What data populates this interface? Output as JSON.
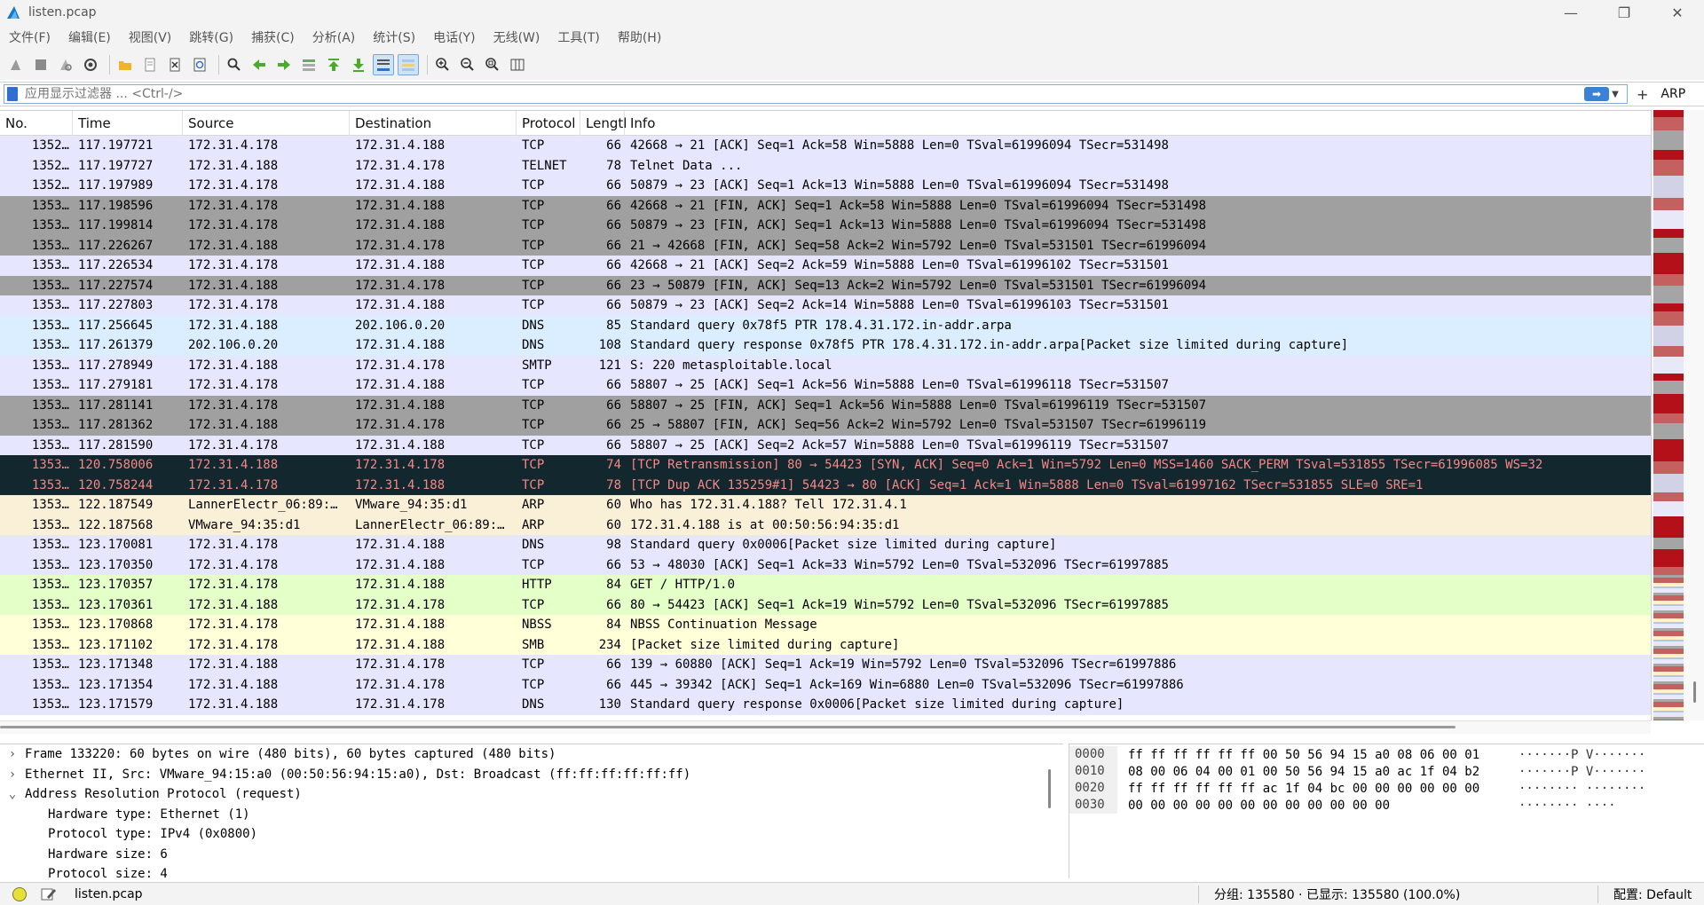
{
  "window": {
    "title": "listen.pcap"
  },
  "menu": [
    "文件(F)",
    "编辑(E)",
    "视图(V)",
    "跳转(G)",
    "捕获(C)",
    "分析(A)",
    "统计(S)",
    "电话(Y)",
    "无线(W)",
    "工具(T)",
    "帮助(H)"
  ],
  "filter": {
    "placeholder": "应用显示过滤器 ... <Ctrl-/>",
    "arp_button": "ARP"
  },
  "columns": [
    "No.",
    "Time",
    "Source",
    "Destination",
    "Protocol",
    "Lengtl",
    "Info"
  ],
  "packets": [
    {
      "no": "1352…",
      "time": "117.197721",
      "src": "172.31.4.178",
      "dst": "172.31.4.188",
      "proto": "TCP",
      "len": "66",
      "info": "42668 → 21 [ACK] Seq=1 Ack=58 Win=5888 Len=0 TSval=61996094 TSecr=531498",
      "cls": "tcp"
    },
    {
      "no": "1352…",
      "time": "117.197727",
      "src": "172.31.4.188",
      "dst": "172.31.4.178",
      "proto": "TELNET",
      "len": "78",
      "info": "Telnet Data ...",
      "cls": "telnet"
    },
    {
      "no": "1352…",
      "time": "117.197989",
      "src": "172.31.4.178",
      "dst": "172.31.4.188",
      "proto": "TCP",
      "len": "66",
      "info": "50879 → 23 [ACK] Seq=1 Ack=13 Win=5888 Len=0 TSval=61996094 TSecr=531498",
      "cls": "tcp"
    },
    {
      "no": "1353…",
      "time": "117.198596",
      "src": "172.31.4.178",
      "dst": "172.31.4.188",
      "proto": "TCP",
      "len": "66",
      "info": "42668 → 21 [FIN, ACK] Seq=1 Ack=58 Win=5888 Len=0 TSval=61996094 TSecr=531498",
      "cls": "fin"
    },
    {
      "no": "1353…",
      "time": "117.199814",
      "src": "172.31.4.178",
      "dst": "172.31.4.188",
      "proto": "TCP",
      "len": "66",
      "info": "50879 → 23 [FIN, ACK] Seq=1 Ack=13 Win=5888 Len=0 TSval=61996094 TSecr=531498",
      "cls": "fin"
    },
    {
      "no": "1353…",
      "time": "117.226267",
      "src": "172.31.4.188",
      "dst": "172.31.4.178",
      "proto": "TCP",
      "len": "66",
      "info": "21 → 42668 [FIN, ACK] Seq=58 Ack=2 Win=5792 Len=0 TSval=531501 TSecr=61996094",
      "cls": "fin"
    },
    {
      "no": "1353…",
      "time": "117.226534",
      "src": "172.31.4.178",
      "dst": "172.31.4.188",
      "proto": "TCP",
      "len": "66",
      "info": "42668 → 21 [ACK] Seq=2 Ack=59 Win=5888 Len=0 TSval=61996102 TSecr=531501",
      "cls": "tcp"
    },
    {
      "no": "1353…",
      "time": "117.227574",
      "src": "172.31.4.188",
      "dst": "172.31.4.178",
      "proto": "TCP",
      "len": "66",
      "info": "23 → 50879 [FIN, ACK] Seq=13 Ack=2 Win=5792 Len=0 TSval=531501 TSecr=61996094",
      "cls": "fin"
    },
    {
      "no": "1353…",
      "time": "117.227803",
      "src": "172.31.4.178",
      "dst": "172.31.4.188",
      "proto": "TCP",
      "len": "66",
      "info": "50879 → 23 [ACK] Seq=2 Ack=14 Win=5888 Len=0 TSval=61996103 TSecr=531501",
      "cls": "tcp"
    },
    {
      "no": "1353…",
      "time": "117.256645",
      "src": "172.31.4.188",
      "dst": "202.106.0.20",
      "proto": "DNS",
      "len": "85",
      "info": "Standard query 0x78f5 PTR 178.4.31.172.in-addr.arpa",
      "cls": "dns"
    },
    {
      "no": "1353…",
      "time": "117.261379",
      "src": "202.106.0.20",
      "dst": "172.31.4.188",
      "proto": "DNS",
      "len": "108",
      "info": "Standard query response 0x78f5 PTR 178.4.31.172.in-addr.arpa[Packet size limited during capture]",
      "cls": "dns"
    },
    {
      "no": "1353…",
      "time": "117.278949",
      "src": "172.31.4.188",
      "dst": "172.31.4.178",
      "proto": "SMTP",
      "len": "121",
      "info": "S: 220 metasploitable.local",
      "cls": "tcp"
    },
    {
      "no": "1353…",
      "time": "117.279181",
      "src": "172.31.4.178",
      "dst": "172.31.4.188",
      "proto": "TCP",
      "len": "66",
      "info": "58807 → 25 [ACK] Seq=1 Ack=56 Win=5888 Len=0 TSval=61996118 TSecr=531507",
      "cls": "tcp"
    },
    {
      "no": "1353…",
      "time": "117.281141",
      "src": "172.31.4.178",
      "dst": "172.31.4.188",
      "proto": "TCP",
      "len": "66",
      "info": "58807 → 25 [FIN, ACK] Seq=1 Ack=56 Win=5888 Len=0 TSval=61996119 TSecr=531507",
      "cls": "fin"
    },
    {
      "no": "1353…",
      "time": "117.281362",
      "src": "172.31.4.188",
      "dst": "172.31.4.178",
      "proto": "TCP",
      "len": "66",
      "info": "25 → 58807 [FIN, ACK] Seq=56 Ack=2 Win=5792 Len=0 TSval=531507 TSecr=61996119",
      "cls": "fin"
    },
    {
      "no": "1353…",
      "time": "117.281590",
      "src": "172.31.4.178",
      "dst": "172.31.4.188",
      "proto": "TCP",
      "len": "66",
      "info": "58807 → 25 [ACK] Seq=2 Ack=57 Win=5888 Len=0 TSval=61996119 TSecr=531507",
      "cls": "tcp"
    },
    {
      "no": "1353…",
      "time": "120.758006",
      "src": "172.31.4.188",
      "dst": "172.31.4.178",
      "proto": "TCP",
      "len": "74",
      "info": "[TCP Retransmission] 80 → 54423 [SYN, ACK] Seq=0 Ack=1 Win=5792 Len=0 MSS=1460 SACK_PERM TSval=531855 TSecr=61996085 WS=32",
      "cls": "bad"
    },
    {
      "no": "1353…",
      "time": "120.758244",
      "src": "172.31.4.178",
      "dst": "172.31.4.188",
      "proto": "TCP",
      "len": "78",
      "info": "[TCP Dup ACK 135259#1] 54423 → 80 [ACK] Seq=1 Ack=1 Win=5888 Len=0 TSval=61997162 TSecr=531855 SLE=0 SRE=1",
      "cls": "bad"
    },
    {
      "no": "1353…",
      "time": "122.187549",
      "src": "LannerElectr_06:89:…",
      "dst": "VMware_94:35:d1",
      "proto": "ARP",
      "len": "60",
      "info": "Who has 172.31.4.188? Tell 172.31.4.1",
      "cls": "arp"
    },
    {
      "no": "1353…",
      "time": "122.187568",
      "src": "VMware_94:35:d1",
      "dst": "LannerElectr_06:89:…",
      "proto": "ARP",
      "len": "60",
      "info": "172.31.4.188 is at 00:50:56:94:35:d1",
      "cls": "arp"
    },
    {
      "no": "1353…",
      "time": "123.170081",
      "src": "172.31.4.178",
      "dst": "172.31.4.188",
      "proto": "DNS",
      "len": "98",
      "info": "Standard query 0x0006[Packet size limited during capture]",
      "cls": "tcp"
    },
    {
      "no": "1353…",
      "time": "123.170350",
      "src": "172.31.4.178",
      "dst": "172.31.4.188",
      "proto": "TCP",
      "len": "66",
      "info": "53 → 48030 [ACK] Seq=1 Ack=33 Win=5792 Len=0 TSval=532096 TSecr=61997885",
      "cls": "tcp"
    },
    {
      "no": "1353…",
      "time": "123.170357",
      "src": "172.31.4.178",
      "dst": "172.31.4.188",
      "proto": "HTTP",
      "len": "84",
      "info": "GET / HTTP/1.0",
      "cls": "http"
    },
    {
      "no": "1353…",
      "time": "123.170361",
      "src": "172.31.4.188",
      "dst": "172.31.4.178",
      "proto": "TCP",
      "len": "66",
      "info": "80 → 54423 [ACK] Seq=1 Ack=19 Win=5792 Len=0 TSval=532096 TSecr=61997885",
      "cls": "http"
    },
    {
      "no": "1353…",
      "time": "123.170868",
      "src": "172.31.4.178",
      "dst": "172.31.4.188",
      "proto": "NBSS",
      "len": "84",
      "info": "NBSS Continuation Message",
      "cls": "nbss"
    },
    {
      "no": "1353…",
      "time": "123.171102",
      "src": "172.31.4.178",
      "dst": "172.31.4.188",
      "proto": "SMB",
      "len": "234",
      "info": "[Packet size limited during capture]",
      "cls": "smb"
    },
    {
      "no": "1353…",
      "time": "123.171348",
      "src": "172.31.4.188",
      "dst": "172.31.4.178",
      "proto": "TCP",
      "len": "66",
      "info": "139 → 60880 [ACK] Seq=1 Ack=19 Win=5792 Len=0 TSval=532096 TSecr=61997886",
      "cls": "tcp"
    },
    {
      "no": "1353…",
      "time": "123.171354",
      "src": "172.31.4.188",
      "dst": "172.31.4.178",
      "proto": "TCP",
      "len": "66",
      "info": "445 → 39342 [ACK] Seq=1 Ack=169 Win=6880 Len=0 TSval=532096 TSecr=61997886",
      "cls": "tcp"
    },
    {
      "no": "1353…",
      "time": "123.171579",
      "src": "172.31.4.188",
      "dst": "172.31.4.178",
      "proto": "DNS",
      "len": "130",
      "info": "Standard query response 0x0006[Packet size limited during capture]",
      "cls": "tcp"
    }
  ],
  "details": [
    {
      "caret": ">",
      "text": "Frame 133220: 60 bytes on wire (480 bits), 60 bytes captured (480 bits)",
      "child": false
    },
    {
      "caret": ">",
      "text": "Ethernet II, Src: VMware_94:15:a0 (00:50:56:94:15:a0), Dst: Broadcast (ff:ff:ff:ff:ff:ff)",
      "child": false
    },
    {
      "caret": "v",
      "text": "Address Resolution Protocol (request)",
      "child": false
    },
    {
      "caret": "",
      "text": "Hardware type: Ethernet (1)",
      "child": true
    },
    {
      "caret": "",
      "text": "Protocol type: IPv4 (0x0800)",
      "child": true
    },
    {
      "caret": "",
      "text": "Hardware size: 6",
      "child": true
    },
    {
      "caret": "",
      "text": "Protocol size: 4",
      "child": true
    }
  ],
  "bytes": [
    {
      "off": "0000",
      "hex": "ff ff ff ff ff ff 00 50  56 94 15 a0 08 06 00 01",
      "ascii": "·······P V·······"
    },
    {
      "off": "0010",
      "hex": "08 00 06 04 00 01 00 50  56 94 15 a0 ac 1f 04 b2",
      "ascii": "·······P V·······"
    },
    {
      "off": "0020",
      "hex": "ff ff ff ff ff ff ac 1f  04 bc 00 00 00 00 00 00",
      "ascii": "········ ········"
    },
    {
      "off": "0030",
      "hex": "00 00 00 00 00 00 00 00  00 00 00 00",
      "ascii": "········ ····"
    }
  ],
  "status": {
    "file": "listen.pcap",
    "stats": "分组: 135580 · 已显示: 135580 (100.0%)",
    "profile": "配置: Default"
  },
  "colors": {
    "tcp": "#e7e6ff",
    "fin": "#a0a0a0",
    "dns": "#daeeff",
    "bad": "#12272e",
    "arp": "#faf0d7",
    "http": "#e4ffc7",
    "smb": "#ffffd8"
  }
}
